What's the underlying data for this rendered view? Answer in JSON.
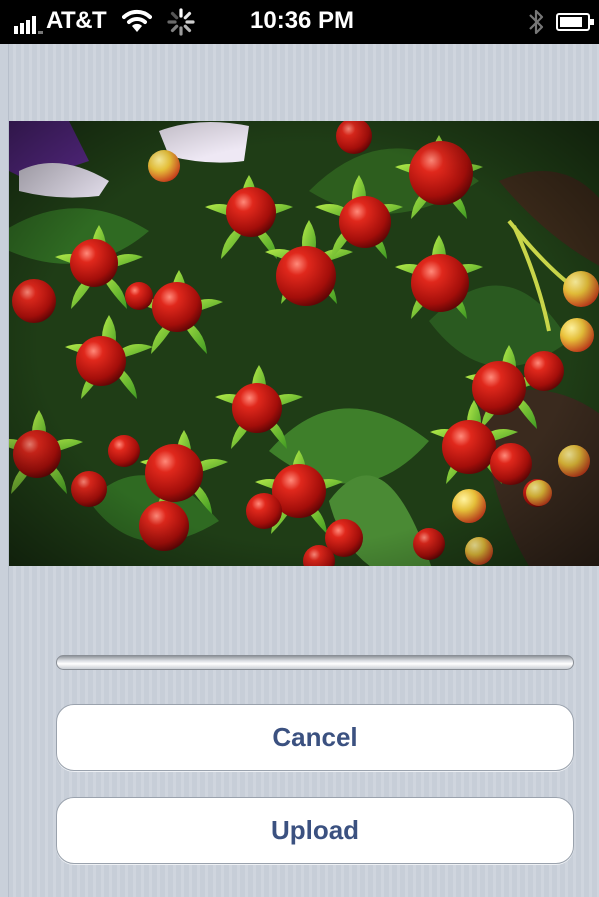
{
  "status_bar": {
    "carrier": "AT&T",
    "time": "10:36 PM",
    "signal_bars": 4,
    "icons": [
      "signal-icon",
      "wifi-icon",
      "activity-icon",
      "bluetooth-icon",
      "battery-icon"
    ]
  },
  "photo": {
    "subject": "red hypericum berries with green leaves",
    "colors": {
      "berry": "#c4120c",
      "leaf": "#5fae2a",
      "dark_leaf": "#234d1b"
    }
  },
  "upload": {
    "progress": 0
  },
  "buttons": {
    "cancel_label": "Cancel",
    "upload_label": "Upload"
  },
  "theme": {
    "button_text": "#3b5180",
    "background": "#c9d0da"
  }
}
